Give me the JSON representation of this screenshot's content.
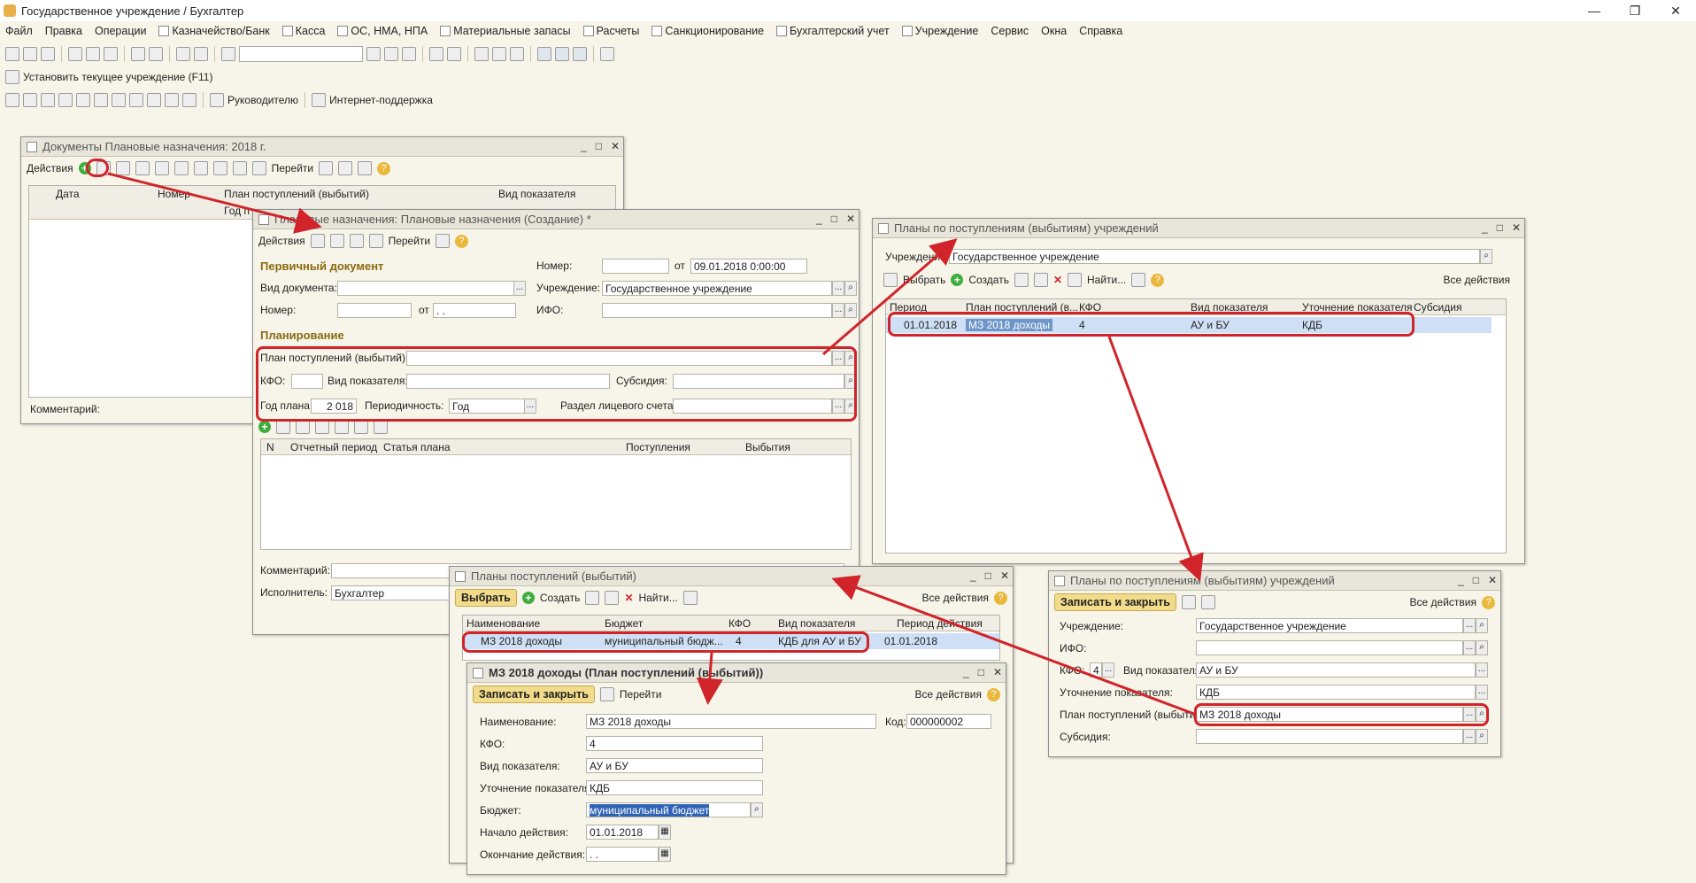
{
  "app": {
    "title": "Государственное учреждение / Бухгалтер",
    "win_controls": [
      "—",
      "❐",
      "✕"
    ]
  },
  "menu": [
    "Файл",
    "Правка",
    "Операции",
    "Казначейство/Банк",
    "Касса",
    "ОС, НМА, НПА",
    "Материальные запасы",
    "Расчеты",
    "Санкционирование",
    "Бухгалтерский учет",
    "Учреждение",
    "Сервис",
    "Окна",
    "Справка"
  ],
  "toolbar2": {
    "set_institution": "Установить текущее учреждение (F11)"
  },
  "toolbar3": {
    "manager": "Руководителю",
    "support": "Интернет-поддержка"
  },
  "w1": {
    "title": "Документы Плановые назначения: 2018 г.",
    "actions": "Действия",
    "goto": "Перейти",
    "columns": [
      "Дата",
      "Номер",
      "План поступлений (выбытий)",
      "Вид показателя"
    ],
    "subcol": "Год п",
    "comment_label": "Комментарий:"
  },
  "w2": {
    "title": "Плановые назначения: Плановые назначения (Создание) *",
    "actions": "Действия",
    "goto": "Перейти",
    "section_primary": "Первичный документ",
    "doc_type_label": "Вид документа:",
    "number_label": "Номер:",
    "number_label2": "Номер:",
    "from_label": "от",
    "from_label2": "от",
    "date_value": "09.01.2018  0:00:00",
    "institution_label": "Учреждение:",
    "institution_value": "Государственное учреждение",
    "ifo_label": "ИФО:",
    "date_empty": " .  .",
    "section_plan": "Планирование",
    "plan_label": "План поступлений (выбытий):",
    "kfo_label": "КФО:",
    "indicator_label": "Вид показателя:",
    "subsidy_label": "Субсидия:",
    "year_label": "Год плана:",
    "year_value": "2 018",
    "period_label": "Периодичность:",
    "period_value": "Год",
    "account_label": "Раздел лицевого счета:",
    "columns": [
      "N",
      "Отчетный период",
      "Статья плана",
      "Поступления",
      "Выбытия"
    ],
    "comment_label": "Комментарий:",
    "executor_label": "Исполнитель:",
    "executor_value": "Бухгалтер"
  },
  "w3": {
    "title": "Планы по поступлениям (выбытиям) учреждений",
    "institution_label": "Учреждение:",
    "institution_value": "Государственное учреждение",
    "select": "Выбрать",
    "create": "Создать",
    "find": "Найти...",
    "all_actions": "Все действия",
    "columns": [
      "Период",
      "План поступлений (в...",
      "КФО",
      "Вид показателя",
      "Уточнение показателя",
      "Субсидия"
    ],
    "row": {
      "period": "01.01.2018",
      "plan": "МЗ 2018 доходы",
      "kfo": "4",
      "indicator": "АУ и БУ",
      "refine": "КДБ",
      "subsidy": ""
    }
  },
  "w4": {
    "title": "Планы поступлений (выбытий)",
    "select": "Выбрать",
    "create": "Создать",
    "find": "Найти...",
    "all_actions": "Все действия",
    "columns": [
      "Наименование",
      "Бюджет",
      "КФО",
      "Вид показателя",
      "Период действия"
    ],
    "row": {
      "name": "МЗ 2018 доходы",
      "budget": "муниципальный бюдж...",
      "kfo": "4",
      "indicator": "КДБ для АУ и БУ",
      "period": "01.01.2018"
    }
  },
  "w5": {
    "title": "МЗ 2018 доходы (План поступлений (выбытий))",
    "save_close": "Записать и закрыть",
    "goto": "Перейти",
    "all_actions": "Все действия",
    "name_label": "Наименование:",
    "name_value": "МЗ 2018 доходы",
    "code_label": "Код:",
    "code_value": "000000002",
    "kfo_label": "КФО:",
    "kfo_value": "4",
    "indicator_label": "Вид показателя:",
    "indicator_value": "АУ и БУ",
    "refine_label": "Уточнение показателя:",
    "refine_value": "КДБ",
    "budget_label": "Бюджет:",
    "budget_value": "муниципальный бюджет",
    "start_label": "Начало действия:",
    "start_value": "01.01.2018",
    "end_label": "Окончание действия:",
    "end_value": " .  ."
  },
  "w6": {
    "title": "Планы по поступлениям (выбытиям) учреждений",
    "save_close": "Записать и закрыть",
    "all_actions": "Все действия",
    "institution_label": "Учреждение:",
    "institution_value": "Государственное учреждение",
    "ifo_label": "ИФО:",
    "kfo_label": "КФО:",
    "kfo_value": "4",
    "indicator_label": "Вид показателя:",
    "indicator_value": "АУ и БУ",
    "refine_label": "Уточнение показателя:",
    "refine_value": "КДБ",
    "plan_label": "План поступлений (выбытий):",
    "plan_value": "МЗ 2018 доходы",
    "subsidy_label": "Субсидия:"
  }
}
